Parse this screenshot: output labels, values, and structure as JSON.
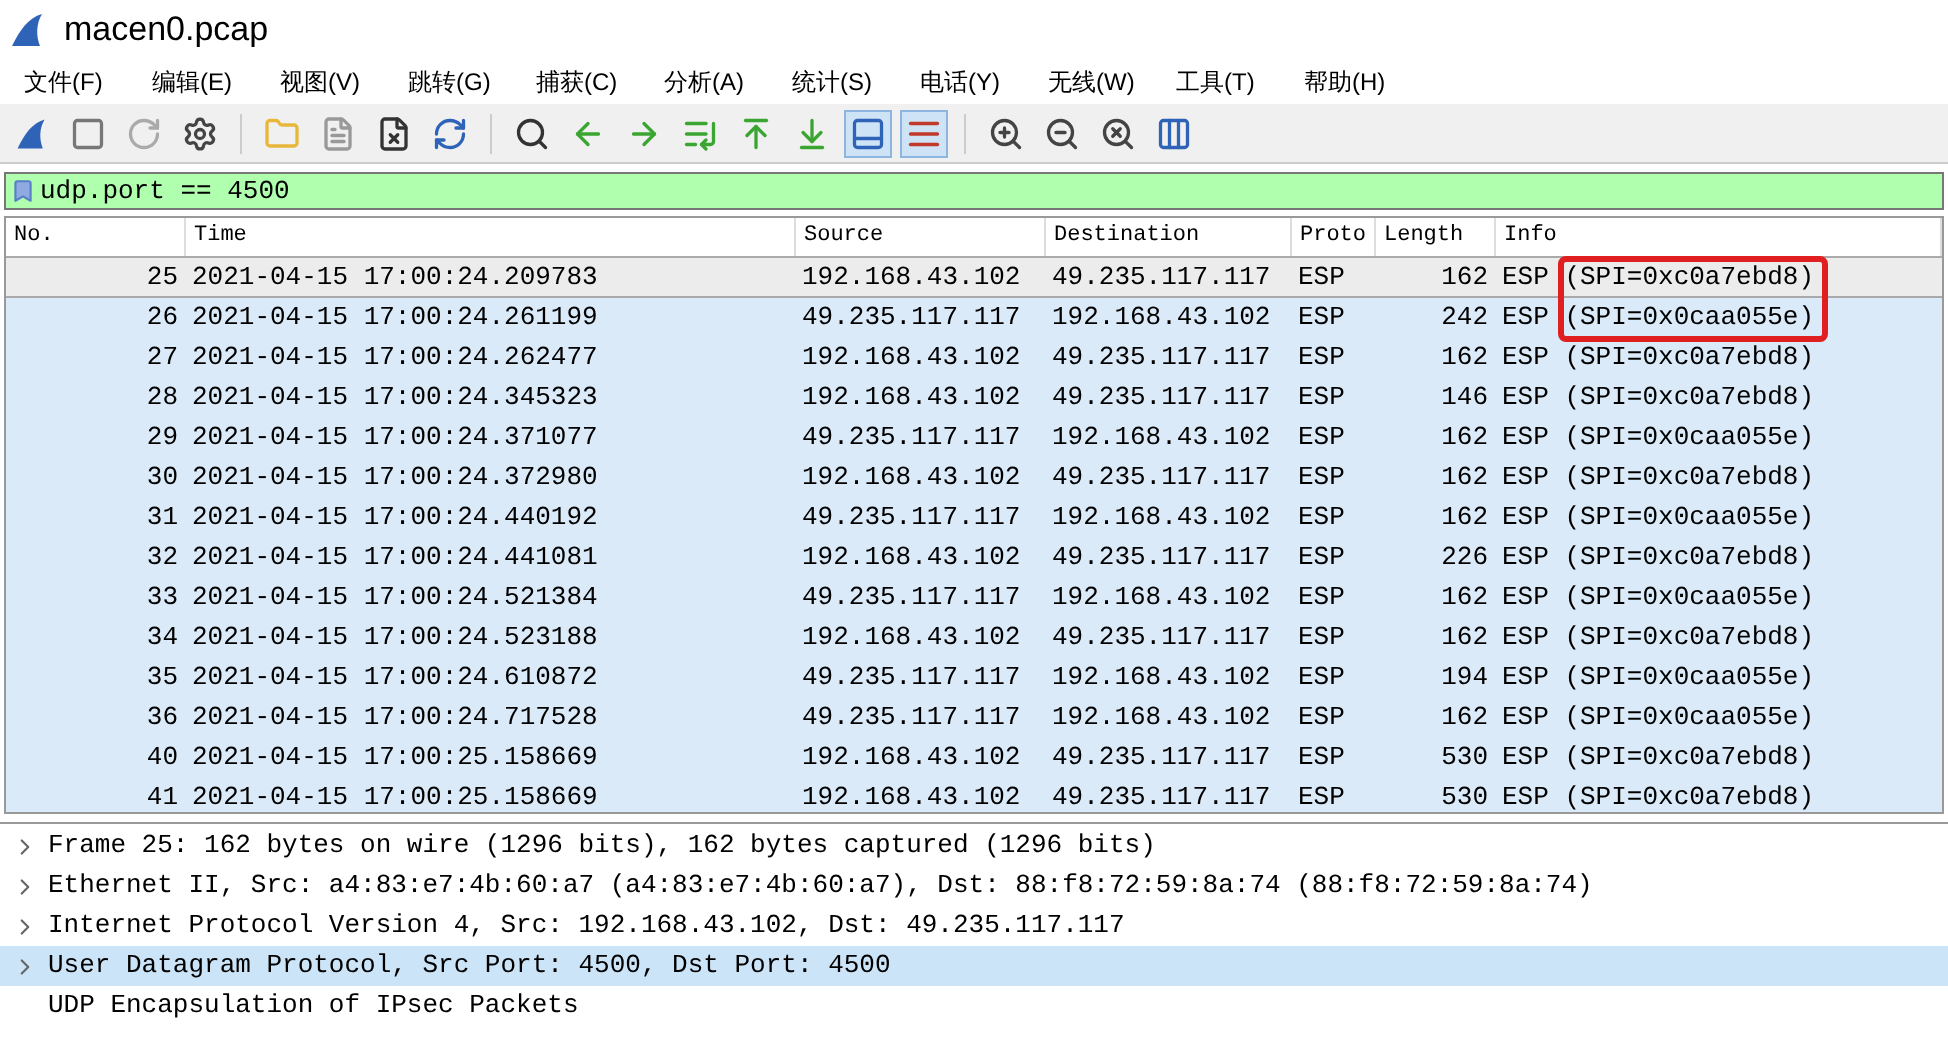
{
  "window": {
    "title": "macen0.pcap"
  },
  "menu": [
    "文件(F)",
    "编辑(E)",
    "视图(V)",
    "跳转(G)",
    "捕获(C)",
    "分析(A)",
    "统计(S)",
    "电话(Y)",
    "无线(W)",
    "工具(T)",
    "帮助(H)"
  ],
  "toolbar": [
    {
      "selected": false
    },
    {
      "selected": false
    },
    {
      "selected": false
    },
    {
      "selected": false
    },
    {
      "selected": false
    },
    {
      "selected": false
    },
    {
      "selected": false
    },
    {
      "selected": false
    },
    {
      "selected": false
    },
    {
      "selected": false
    },
    {
      "selected": false
    },
    {
      "selected": false
    },
    {
      "selected": false
    },
    {
      "selected": false
    },
    {
      "selected": true
    },
    {
      "selected": true
    },
    {
      "selected": false
    },
    {
      "selected": false
    },
    {
      "selected": false
    },
    {
      "selected": false
    }
  ],
  "filter": {
    "value": "udp.port == 4500"
  },
  "table": {
    "columns": [
      "No.",
      "Time",
      "Source",
      "Destination",
      "Proto",
      "Length",
      "Info"
    ],
    "rows": [
      {
        "cells": [
          "25",
          "2021-04-15 17:00:24.209783",
          "192.168.43.102",
          "49.235.117.117",
          "ESP",
          "162",
          "ESP (SPI=0xc0a7ebd8)"
        ],
        "selected": true,
        "highlighted": true
      },
      {
        "cells": [
          "26",
          "2021-04-15 17:00:24.261199",
          "49.235.117.117",
          "192.168.43.102",
          "ESP",
          "242",
          "ESP (SPI=0x0caa055e)"
        ],
        "selected": false,
        "highlighted": true
      },
      {
        "cells": [
          "27",
          "2021-04-15 17:00:24.262477",
          "192.168.43.102",
          "49.235.117.117",
          "ESP",
          "162",
          "ESP (SPI=0xc0a7ebd8)"
        ],
        "selected": false,
        "highlighted": false
      },
      {
        "cells": [
          "28",
          "2021-04-15 17:00:24.345323",
          "192.168.43.102",
          "49.235.117.117",
          "ESP",
          "146",
          "ESP (SPI=0xc0a7ebd8)"
        ],
        "selected": false,
        "highlighted": false
      },
      {
        "cells": [
          "29",
          "2021-04-15 17:00:24.371077",
          "49.235.117.117",
          "192.168.43.102",
          "ESP",
          "162",
          "ESP (SPI=0x0caa055e)"
        ],
        "selected": false,
        "highlighted": false
      },
      {
        "cells": [
          "30",
          "2021-04-15 17:00:24.372980",
          "192.168.43.102",
          "49.235.117.117",
          "ESP",
          "162",
          "ESP (SPI=0xc0a7ebd8)"
        ],
        "selected": false,
        "highlighted": false
      },
      {
        "cells": [
          "31",
          "2021-04-15 17:00:24.440192",
          "49.235.117.117",
          "192.168.43.102",
          "ESP",
          "162",
          "ESP (SPI=0x0caa055e)"
        ],
        "selected": false,
        "highlighted": false
      },
      {
        "cells": [
          "32",
          "2021-04-15 17:00:24.441081",
          "192.168.43.102",
          "49.235.117.117",
          "ESP",
          "226",
          "ESP (SPI=0xc0a7ebd8)"
        ],
        "selected": false,
        "highlighted": false
      },
      {
        "cells": [
          "33",
          "2021-04-15 17:00:24.521384",
          "49.235.117.117",
          "192.168.43.102",
          "ESP",
          "162",
          "ESP (SPI=0x0caa055e)"
        ],
        "selected": false,
        "highlighted": false
      },
      {
        "cells": [
          "34",
          "2021-04-15 17:00:24.523188",
          "192.168.43.102",
          "49.235.117.117",
          "ESP",
          "162",
          "ESP (SPI=0xc0a7ebd8)"
        ],
        "selected": false,
        "highlighted": false
      },
      {
        "cells": [
          "35",
          "2021-04-15 17:00:24.610872",
          "49.235.117.117",
          "192.168.43.102",
          "ESP",
          "194",
          "ESP (SPI=0x0caa055e)"
        ],
        "selected": false,
        "highlighted": false
      },
      {
        "cells": [
          "36",
          "2021-04-15 17:00:24.717528",
          "49.235.117.117",
          "192.168.43.102",
          "ESP",
          "162",
          "ESP (SPI=0x0caa055e)"
        ],
        "selected": false,
        "highlighted": false
      },
      {
        "cells": [
          "40",
          "2021-04-15 17:00:25.158669",
          "192.168.43.102",
          "49.235.117.117",
          "ESP",
          "530",
          "ESP (SPI=0xc0a7ebd8)"
        ],
        "selected": false,
        "highlighted": false
      },
      {
        "cells": [
          "41",
          "2021-04-15 17:00:25.158669",
          "192.168.43.102",
          "49.235.117.117",
          "ESP",
          "530",
          "ESP (SPI=0xc0a7ebd8)"
        ],
        "selected": false,
        "highlighted": false
      }
    ]
  },
  "details": [
    {
      "text": "Frame 25: 162 bytes on wire (1296 bits), 162 bytes captured (1296 bits)",
      "expandable": true,
      "selected": false
    },
    {
      "text": "Ethernet II, Src: a4:83:e7:4b:60:a7 (a4:83:e7:4b:60:a7), Dst: 88:f8:72:59:8a:74 (88:f8:72:59:8a:74)",
      "expandable": true,
      "selected": false
    },
    {
      "text": "Internet Protocol Version 4, Src: 192.168.43.102, Dst: 49.235.117.117",
      "expandable": true,
      "selected": false
    },
    {
      "text": "User Datagram Protocol, Src Port: 4500, Dst Port: 4500",
      "expandable": true,
      "selected": true
    },
    {
      "text": "UDP Encapsulation of IPsec Packets",
      "expandable": false,
      "selected": false
    }
  ]
}
